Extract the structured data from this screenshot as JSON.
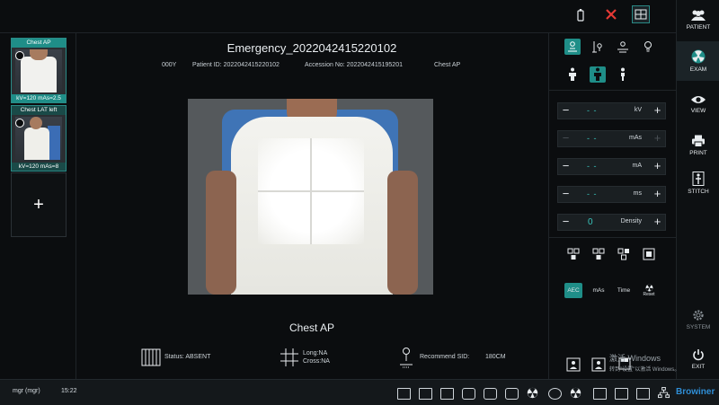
{
  "nav": {
    "items": [
      {
        "label": "PATIENT"
      },
      {
        "label": "EXAM"
      },
      {
        "label": "VIEW"
      },
      {
        "label": "PRINT"
      },
      {
        "label": "STITCH"
      },
      {
        "label": "SYSTEM"
      },
      {
        "label": "EXIT"
      }
    ]
  },
  "thumbnails": [
    {
      "title": "Chest AP",
      "params": "kV=120 mAs=2.5",
      "selected": true
    },
    {
      "title": "Chest LAT left",
      "params": "kV=120 mAs=8",
      "selected": false
    }
  ],
  "add_view_label": "+",
  "study": {
    "title": "Emergency_2022042415220102",
    "age": "000Y",
    "patient_id": "Patient ID: 2022042415220102",
    "accession": "Accession No: 2022042415195201",
    "protocol": "Chest AP"
  },
  "view_name": "Chest AP",
  "status": {
    "grid_status": "Status: ABSENT",
    "long": "Long:NA",
    "cross": "Cross:NA",
    "recommend_sid_label": "Recommend SID:",
    "recommend_sid_value": "180CM"
  },
  "params": [
    {
      "unit": "kV",
      "value": "- -",
      "minus": "−",
      "plus": "+",
      "enabled": true
    },
    {
      "unit": "mAs",
      "value": "- -",
      "minus": "−",
      "plus": "+",
      "enabled": false
    },
    {
      "unit": "mA",
      "value": "- -",
      "minus": "−",
      "plus": "+",
      "enabled": true
    },
    {
      "unit": "ms",
      "value": "- -",
      "minus": "−",
      "plus": "+",
      "enabled": true
    },
    {
      "unit": "Density",
      "value": "0",
      "minus": "−",
      "plus": "+",
      "enabled": true
    }
  ],
  "exposure_modes": [
    {
      "label": "AEC",
      "active": true
    },
    {
      "label": "mAs",
      "active": false
    },
    {
      "label": "Time",
      "active": false
    },
    {
      "label": "Reset",
      "active": false
    }
  ],
  "user": "mgr (mgr)",
  "clock": "15:22",
  "watermark": {
    "line1": "激活 Windows",
    "line2": "转到\"设置\"以激活 Windows。"
  },
  "brand": "Browiner",
  "colors": {
    "accent": "#1f8e88",
    "accent_text": "#39c6bd",
    "danger": "#e53935",
    "background": "#0b0d0f"
  }
}
